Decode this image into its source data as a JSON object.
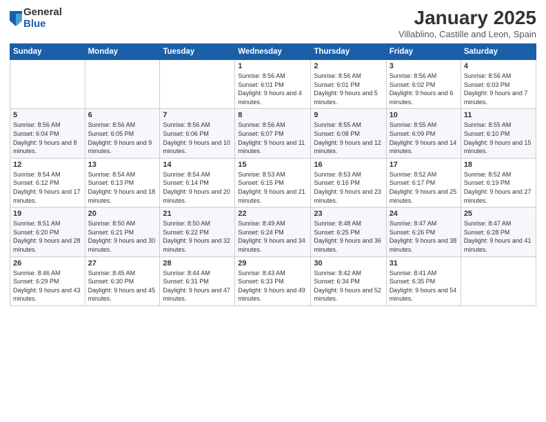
{
  "logo": {
    "general": "General",
    "blue": "Blue"
  },
  "header": {
    "title": "January 2025",
    "location": "Villablino, Castille and Leon, Spain"
  },
  "weekdays": [
    "Sunday",
    "Monday",
    "Tuesday",
    "Wednesday",
    "Thursday",
    "Friday",
    "Saturday"
  ],
  "weeks": [
    [
      {
        "day": "",
        "info": ""
      },
      {
        "day": "",
        "info": ""
      },
      {
        "day": "",
        "info": ""
      },
      {
        "day": "1",
        "info": "Sunrise: 8:56 AM\nSunset: 6:01 PM\nDaylight: 9 hours\nand 4 minutes."
      },
      {
        "day": "2",
        "info": "Sunrise: 8:56 AM\nSunset: 6:01 PM\nDaylight: 9 hours\nand 5 minutes."
      },
      {
        "day": "3",
        "info": "Sunrise: 8:56 AM\nSunset: 6:02 PM\nDaylight: 9 hours\nand 6 minutes."
      },
      {
        "day": "4",
        "info": "Sunrise: 8:56 AM\nSunset: 6:03 PM\nDaylight: 9 hours\nand 7 minutes."
      }
    ],
    [
      {
        "day": "5",
        "info": "Sunrise: 8:56 AM\nSunset: 6:04 PM\nDaylight: 9 hours\nand 8 minutes."
      },
      {
        "day": "6",
        "info": "Sunrise: 8:56 AM\nSunset: 6:05 PM\nDaylight: 9 hours\nand 9 minutes."
      },
      {
        "day": "7",
        "info": "Sunrise: 8:56 AM\nSunset: 6:06 PM\nDaylight: 9 hours\nand 10 minutes."
      },
      {
        "day": "8",
        "info": "Sunrise: 8:56 AM\nSunset: 6:07 PM\nDaylight: 9 hours\nand 11 minutes."
      },
      {
        "day": "9",
        "info": "Sunrise: 8:55 AM\nSunset: 6:08 PM\nDaylight: 9 hours\nand 12 minutes."
      },
      {
        "day": "10",
        "info": "Sunrise: 8:55 AM\nSunset: 6:09 PM\nDaylight: 9 hours\nand 14 minutes."
      },
      {
        "day": "11",
        "info": "Sunrise: 8:55 AM\nSunset: 6:10 PM\nDaylight: 9 hours\nand 15 minutes."
      }
    ],
    [
      {
        "day": "12",
        "info": "Sunrise: 8:54 AM\nSunset: 6:12 PM\nDaylight: 9 hours\nand 17 minutes."
      },
      {
        "day": "13",
        "info": "Sunrise: 8:54 AM\nSunset: 6:13 PM\nDaylight: 9 hours\nand 18 minutes."
      },
      {
        "day": "14",
        "info": "Sunrise: 8:54 AM\nSunset: 6:14 PM\nDaylight: 9 hours\nand 20 minutes."
      },
      {
        "day": "15",
        "info": "Sunrise: 8:53 AM\nSunset: 6:15 PM\nDaylight: 9 hours\nand 21 minutes."
      },
      {
        "day": "16",
        "info": "Sunrise: 8:53 AM\nSunset: 6:16 PM\nDaylight: 9 hours\nand 23 minutes."
      },
      {
        "day": "17",
        "info": "Sunrise: 8:52 AM\nSunset: 6:17 PM\nDaylight: 9 hours\nand 25 minutes."
      },
      {
        "day": "18",
        "info": "Sunrise: 8:52 AM\nSunset: 6:19 PM\nDaylight: 9 hours\nand 27 minutes."
      }
    ],
    [
      {
        "day": "19",
        "info": "Sunrise: 8:51 AM\nSunset: 6:20 PM\nDaylight: 9 hours\nand 28 minutes."
      },
      {
        "day": "20",
        "info": "Sunrise: 8:50 AM\nSunset: 6:21 PM\nDaylight: 9 hours\nand 30 minutes."
      },
      {
        "day": "21",
        "info": "Sunrise: 8:50 AM\nSunset: 6:22 PM\nDaylight: 9 hours\nand 32 minutes."
      },
      {
        "day": "22",
        "info": "Sunrise: 8:49 AM\nSunset: 6:24 PM\nDaylight: 9 hours\nand 34 minutes."
      },
      {
        "day": "23",
        "info": "Sunrise: 8:48 AM\nSunset: 6:25 PM\nDaylight: 9 hours\nand 36 minutes."
      },
      {
        "day": "24",
        "info": "Sunrise: 8:47 AM\nSunset: 6:26 PM\nDaylight: 9 hours\nand 38 minutes."
      },
      {
        "day": "25",
        "info": "Sunrise: 8:47 AM\nSunset: 6:28 PM\nDaylight: 9 hours\nand 41 minutes."
      }
    ],
    [
      {
        "day": "26",
        "info": "Sunrise: 8:46 AM\nSunset: 6:29 PM\nDaylight: 9 hours\nand 43 minutes."
      },
      {
        "day": "27",
        "info": "Sunrise: 8:45 AM\nSunset: 6:30 PM\nDaylight: 9 hours\nand 45 minutes."
      },
      {
        "day": "28",
        "info": "Sunrise: 8:44 AM\nSunset: 6:31 PM\nDaylight: 9 hours\nand 47 minutes."
      },
      {
        "day": "29",
        "info": "Sunrise: 8:43 AM\nSunset: 6:33 PM\nDaylight: 9 hours\nand 49 minutes."
      },
      {
        "day": "30",
        "info": "Sunrise: 8:42 AM\nSunset: 6:34 PM\nDaylight: 9 hours\nand 52 minutes."
      },
      {
        "day": "31",
        "info": "Sunrise: 8:41 AM\nSunset: 6:35 PM\nDaylight: 9 hours\nand 54 minutes."
      },
      {
        "day": "",
        "info": ""
      }
    ]
  ]
}
